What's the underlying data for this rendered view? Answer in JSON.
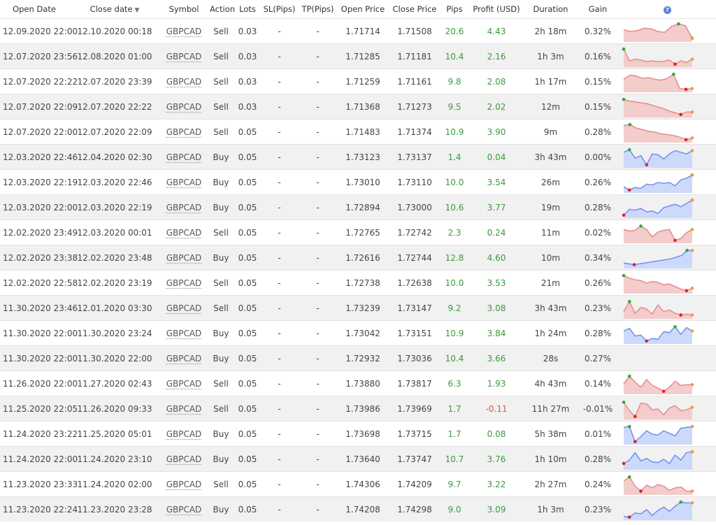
{
  "headers": {
    "open_date": "Open Date",
    "close_date": "Close date",
    "symbol": "Symbol",
    "action": "Action",
    "lots": "Lots",
    "sl": "SL(Pips)",
    "tp": "TP(Pips)",
    "open_price": "Open Price",
    "close_price": "Close Price",
    "pips": "Pips",
    "profit": "Profit (USD)",
    "duration": "Duration",
    "gain": "Gain",
    "help": "?"
  },
  "colors": {
    "positive": "#3a9a3a",
    "negative": "#d9534f",
    "sell_line": "#e88a8a",
    "sell_fill": "#f3cccc",
    "buy_line": "#6f8ff0",
    "buy_fill": "#cdd9fb",
    "row_alt": "#f1f1f1"
  },
  "rows": [
    {
      "open": "12.09.2020 22:00",
      "close": "12.10.2020 00:18",
      "symbol": "GBPCAD",
      "action": "Sell",
      "lots": "0.03",
      "sl": "-",
      "tp": "-",
      "open_price": "1.71714",
      "close_price": "1.71508",
      "pips": "20.6",
      "profit": "4.43",
      "duration": "2h 18m",
      "gain": "0.32%",
      "spark": [
        0.4,
        0.5,
        0.45,
        0.3,
        0.35,
        0.5,
        0.55,
        0.2,
        0.05,
        0.15,
        0.9
      ]
    },
    {
      "open": "12.07.2020 23:56",
      "close": "12.08.2020 01:00",
      "symbol": "GBPCAD",
      "action": "Sell",
      "lots": "0.03",
      "sl": "-",
      "tp": "-",
      "open_price": "1.71285",
      "close_price": "1.71181",
      "pips": "10.4",
      "profit": "2.16",
      "duration": "1h 3m",
      "gain": "0.16%",
      "spark": [
        0.05,
        0.75,
        0.65,
        0.7,
        0.8,
        0.75,
        0.8,
        0.78,
        0.7,
        0.95,
        0.75,
        0.85,
        0.65
      ]
    },
    {
      "open": "12.07.2020 22:22",
      "close": "12.07.2020 23:39",
      "symbol": "GBPCAD",
      "action": "Sell",
      "lots": "0.03",
      "sl": "-",
      "tp": "-",
      "open_price": "1.71259",
      "close_price": "1.71161",
      "pips": "9.8",
      "profit": "2.08",
      "duration": "1h 17m",
      "gain": "0.15%",
      "spark": [
        0.35,
        0.1,
        0.15,
        0.3,
        0.25,
        0.35,
        0.4,
        0.3,
        0.05,
        0.9,
        0.95,
        0.9
      ]
    },
    {
      "open": "12.07.2020 22:09",
      "close": "12.07.2020 22:22",
      "symbol": "GBPCAD",
      "action": "Sell",
      "lots": "0.03",
      "sl": "-",
      "tp": "-",
      "open_price": "1.71368",
      "close_price": "1.71273",
      "pips": "9.5",
      "profit": "2.02",
      "duration": "12m",
      "gain": "0.15%",
      "spark": [
        0.05,
        0.15,
        0.2,
        0.25,
        0.3,
        0.4,
        0.5,
        0.6,
        0.75,
        0.85,
        0.95,
        0.8,
        0.8
      ]
    },
    {
      "open": "12.07.2020 22:00",
      "close": "12.07.2020 22:09",
      "symbol": "GBPCAD",
      "action": "Sell",
      "lots": "0.05",
      "sl": "-",
      "tp": "-",
      "open_price": "1.71483",
      "close_price": "1.71374",
      "pips": "10.9",
      "profit": "3.90",
      "duration": "9m",
      "gain": "0.28%",
      "spark": [
        0.1,
        0.05,
        0.25,
        0.35,
        0.45,
        0.5,
        0.6,
        0.65,
        0.7,
        0.8,
        0.95,
        0.85
      ]
    },
    {
      "open": "12.03.2020 22:46",
      "close": "12.04.2020 02:30",
      "symbol": "GBPCAD",
      "action": "Buy",
      "lots": "0.05",
      "sl": "-",
      "tp": "-",
      "open_price": "1.73123",
      "close_price": "1.73137",
      "pips": "1.4",
      "profit": "0.04",
      "duration": "3h 43m",
      "gain": "0.00%",
      "spark": [
        0.2,
        0.05,
        0.55,
        0.4,
        0.95,
        0.3,
        0.35,
        0.6,
        0.3,
        0.1,
        0.2,
        0.3,
        0.1
      ]
    },
    {
      "open": "12.03.2020 22:19",
      "close": "12.03.2020 22:46",
      "symbol": "GBPCAD",
      "action": "Buy",
      "lots": "0.05",
      "sl": "-",
      "tp": "-",
      "open_price": "1.73010",
      "close_price": "1.73110",
      "pips": "10.0",
      "profit": "3.54",
      "duration": "26m",
      "gain": "0.26%",
      "spark": [
        0.75,
        0.95,
        0.8,
        0.85,
        0.6,
        0.65,
        0.5,
        0.55,
        0.5,
        0.7,
        0.35,
        0.25,
        0.05
      ]
    },
    {
      "open": "12.03.2020 22:00",
      "close": "12.03.2020 22:19",
      "symbol": "GBPCAD",
      "action": "Buy",
      "lots": "0.05",
      "sl": "-",
      "tp": "-",
      "open_price": "1.72894",
      "close_price": "1.73000",
      "pips": "10.6",
      "profit": "3.77",
      "duration": "19m",
      "gain": "0.28%",
      "spark": [
        0.95,
        0.6,
        0.65,
        0.55,
        0.75,
        0.7,
        0.85,
        0.5,
        0.4,
        0.3,
        0.45,
        0.25,
        0.05
      ]
    },
    {
      "open": "12.02.2020 23:49",
      "close": "12.03.2020 00:01",
      "symbol": "GBPCAD",
      "action": "Sell",
      "lots": "0.05",
      "sl": "-",
      "tp": "-",
      "open_price": "1.72765",
      "close_price": "1.72742",
      "pips": "2.3",
      "profit": "0.24",
      "duration": "11m",
      "gain": "0.02%",
      "spark": [
        0.3,
        0.4,
        0.35,
        0.1,
        0.3,
        0.75,
        0.45,
        0.35,
        0.3,
        0.95,
        0.85,
        0.5,
        0.3
      ]
    },
    {
      "open": "12.02.2020 23:38",
      "close": "12.02.2020 23:48",
      "symbol": "GBPCAD",
      "action": "Buy",
      "lots": "0.05",
      "sl": "-",
      "tp": "-",
      "open_price": "1.72616",
      "close_price": "1.72744",
      "pips": "12.8",
      "profit": "4.60",
      "duration": "10m",
      "gain": "0.34%",
      "spark": [
        0.8,
        0.85,
        0.9,
        0.85,
        0.8,
        0.75,
        0.7,
        0.65,
        0.6,
        0.55,
        0.45,
        0.35,
        0.05,
        0.05
      ]
    },
    {
      "open": "12.02.2020 22:58",
      "close": "12.02.2020 23:19",
      "symbol": "GBPCAD",
      "action": "Sell",
      "lots": "0.05",
      "sl": "-",
      "tp": "-",
      "open_price": "1.72738",
      "close_price": "1.72638",
      "pips": "10.0",
      "profit": "3.53",
      "duration": "21m",
      "gain": "0.26%",
      "spark": [
        0.05,
        0.2,
        0.3,
        0.35,
        0.5,
        0.4,
        0.45,
        0.6,
        0.55,
        0.7,
        0.85,
        0.95,
        0.8
      ]
    },
    {
      "open": "11.30.2020 23:46",
      "close": "12.01.2020 03:30",
      "symbol": "GBPCAD",
      "action": "Sell",
      "lots": "0.05",
      "sl": "-",
      "tp": "-",
      "open_price": "1.73239",
      "close_price": "1.73147",
      "pips": "9.2",
      "profit": "3.08",
      "duration": "3h 43m",
      "gain": "0.23%",
      "spark": [
        0.7,
        0.1,
        0.8,
        0.45,
        0.55,
        0.85,
        0.3,
        0.7,
        0.6,
        0.8,
        0.9,
        0.85,
        0.9
      ]
    },
    {
      "open": "11.30.2020 22:00",
      "close": "11.30.2020 23:24",
      "symbol": "GBPCAD",
      "action": "Buy",
      "lots": "0.05",
      "sl": "-",
      "tp": "-",
      "open_price": "1.73042",
      "close_price": "1.73151",
      "pips": "10.9",
      "profit": "3.84",
      "duration": "1h 24m",
      "gain": "0.28%",
      "spark": [
        0.35,
        0.2,
        0.65,
        0.6,
        0.95,
        0.8,
        0.85,
        0.4,
        0.45,
        0.1,
        0.55,
        0.15,
        0.35
      ]
    },
    {
      "open": "11.30.2020 22:00",
      "close": "11.30.2020 22:00",
      "symbol": "GBPCAD",
      "action": "Buy",
      "lots": "0.05",
      "sl": "-",
      "tp": "-",
      "open_price": "1.72932",
      "close_price": "1.73036",
      "pips": "10.4",
      "profit": "3.66",
      "duration": "28s",
      "gain": "0.27%",
      "spark": []
    },
    {
      "open": "11.26.2020 22:00",
      "close": "11.27.2020 02:43",
      "symbol": "GBPCAD",
      "action": "Sell",
      "lots": "0.05",
      "sl": "-",
      "tp": "-",
      "open_price": "1.73880",
      "close_price": "1.73817",
      "pips": "6.3",
      "profit": "1.93",
      "duration": "4h 43m",
      "gain": "0.14%",
      "spark": [
        0.5,
        0.05,
        0.4,
        0.7,
        0.25,
        0.6,
        0.75,
        0.95,
        0.7,
        0.35,
        0.6,
        0.55,
        0.55
      ]
    },
    {
      "open": "11.25.2020 22:05",
      "close": "11.26.2020 09:33",
      "symbol": "GBPCAD",
      "action": "Sell",
      "lots": "0.05",
      "sl": "-",
      "tp": "-",
      "open_price": "1.73986",
      "close_price": "1.73969",
      "pips": "1.7",
      "profit": "-0.11",
      "duration": "11h 27m",
      "gain": "-0.01%",
      "spark": [
        0.1,
        0.6,
        0.95,
        0.15,
        0.2,
        0.55,
        0.5,
        0.85,
        0.45,
        0.3,
        0.6,
        0.55,
        0.4
      ]
    },
    {
      "open": "11.24.2020 23:22",
      "close": "11.25.2020 05:01",
      "symbol": "GBPCAD",
      "action": "Buy",
      "lots": "0.05",
      "sl": "-",
      "tp": "-",
      "open_price": "1.73698",
      "close_price": "1.73715",
      "pips": "1.7",
      "profit": "0.08",
      "duration": "5h 38m",
      "gain": "0.01%",
      "spark": [
        0.1,
        0.05,
        0.95,
        0.65,
        0.3,
        0.5,
        0.55,
        0.3,
        0.45,
        0.6,
        0.15,
        0.1,
        0.05
      ]
    },
    {
      "open": "11.24.2020 22:00",
      "close": "11.24.2020 23:10",
      "symbol": "GBPCAD",
      "action": "Buy",
      "lots": "0.05",
      "sl": "-",
      "tp": "-",
      "open_price": "1.73640",
      "close_price": "1.73747",
      "pips": "10.7",
      "profit": "3.76",
      "duration": "1h 10m",
      "gain": "0.28%",
      "spark": [
        0.75,
        0.55,
        0.1,
        0.6,
        0.45,
        0.65,
        0.7,
        0.5,
        0.75,
        0.25,
        0.55,
        0.1,
        0.05
      ]
    },
    {
      "open": "11.23.2020 23:33",
      "close": "11.24.2020 02:00",
      "symbol": "GBPCAD",
      "action": "Sell",
      "lots": "0.05",
      "sl": "-",
      "tp": "-",
      "open_price": "1.74306",
      "close_price": "1.74209",
      "pips": "9.7",
      "profit": "3.22",
      "duration": "2h 27m",
      "gain": "0.24%",
      "spark": [
        0.3,
        0.05,
        0.6,
        0.9,
        0.55,
        0.7,
        0.5,
        0.6,
        0.85,
        0.7,
        0.65,
        0.9,
        0.9
      ]
    },
    {
      "open": "11.23.2020 22:24",
      "close": "11.23.2020 23:28",
      "symbol": "GBPCAD",
      "action": "Buy",
      "lots": "0.05",
      "sl": "-",
      "tp": "-",
      "open_price": "1.74208",
      "close_price": "1.74298",
      "pips": "9.0",
      "profit": "3.09",
      "duration": "1h 3m",
      "gain": "0.23%",
      "spark": [
        0.9,
        0.95,
        0.7,
        0.75,
        0.5,
        0.85,
        0.55,
        0.35,
        0.6,
        0.3,
        0.05,
        0.1,
        0.1
      ]
    }
  ]
}
